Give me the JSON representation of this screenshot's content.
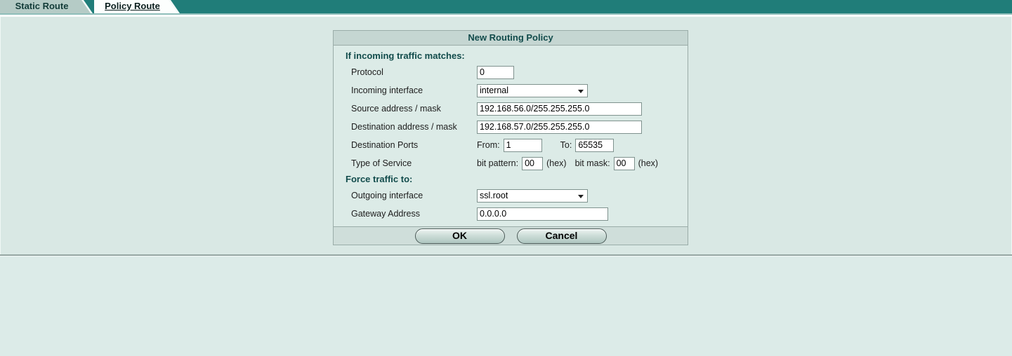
{
  "colors": {
    "topbar_teal": "#207d79",
    "content_bg": "#d9e8e4",
    "page_bg": "#dcebe8",
    "panel_header_bg": "#c5d6d2",
    "heading_text": "#114b4b",
    "inactive_tab_bg": "#b5cbc6",
    "active_tab_bg": "#fcfefd"
  },
  "tabs": {
    "static_route": {
      "label": "Static Route",
      "active": false
    },
    "policy_route": {
      "label": "Policy Route",
      "active": true
    }
  },
  "panel": {
    "title": "New Routing Policy",
    "match_section": {
      "heading": "If incoming traffic matches:"
    },
    "force_section": {
      "heading": "Force traffic to:"
    },
    "fields": {
      "protocol": {
        "label": "Protocol",
        "value": "0"
      },
      "incoming_interface": {
        "label": "Incoming interface",
        "value": "internal"
      },
      "source": {
        "label": "Source address / mask",
        "value": "192.168.56.0/255.255.255.0"
      },
      "destination": {
        "label": "Destination address / mask",
        "value": "192.168.57.0/255.255.255.0"
      },
      "dest_ports": {
        "label": "Destination Ports",
        "from_label": "From:",
        "from_value": "1",
        "to_label": "To:",
        "to_value": "65535"
      },
      "tos": {
        "label": "Type of Service",
        "bit_pattern_label": "bit pattern:",
        "bit_pattern_value": "00",
        "bit_pattern_unit": "(hex)",
        "bit_mask_label": "bit mask:",
        "bit_mask_value": "00",
        "bit_mask_unit": "(hex)"
      },
      "outgoing_interface": {
        "label": "Outgoing interface",
        "value": "ssl.root"
      },
      "gateway": {
        "label": "Gateway Address",
        "value": "0.0.0.0"
      }
    },
    "buttons": {
      "ok": "OK",
      "cancel": "Cancel"
    }
  }
}
